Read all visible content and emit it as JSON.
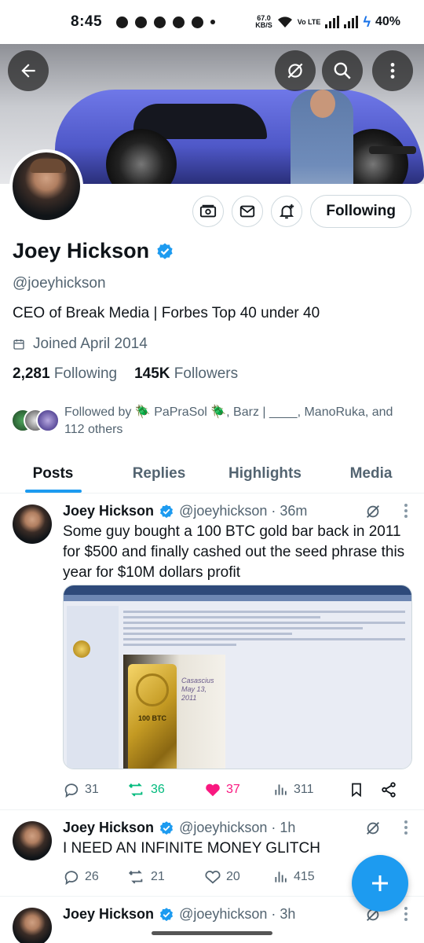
{
  "status_bar": {
    "time": "8:45",
    "net_speed": "67.0",
    "net_unit": "KB/S",
    "volte": "Vo LTE",
    "battery": "40%"
  },
  "profile": {
    "name": "Joey Hickson",
    "handle": "@joeyhickson",
    "bio": "CEO of Break Media | Forbes Top 40 under 40",
    "joined": "Joined April 2014",
    "following_count": "2,281",
    "following_label": "Following",
    "followers_count": "145K",
    "followers_label": "Followers",
    "follow_button": "Following",
    "followed_by": "Followed by 🪲 PaPraSol 🪲, Barz | ____, ManoRuka, and 112 others"
  },
  "tabs": [
    {
      "label": "Posts",
      "active": true
    },
    {
      "label": "Replies",
      "active": false
    },
    {
      "label": "Highlights",
      "active": false
    },
    {
      "label": "Media",
      "active": false
    }
  ],
  "tweets": [
    {
      "name": "Joey Hickson",
      "handle_time": "@joeyhickson · 36m",
      "text": "Some guy bought a 100 BTC gold bar back in 2011 for $500 and finally cashed out the seed phrase this year for $10M dollars profit",
      "replies": "31",
      "retweets": "36",
      "likes": "37",
      "views": "311",
      "media_label": "100 BTC",
      "media_note": "Casascius May 13, 2011"
    },
    {
      "name": "Joey Hickson",
      "handle_time": "@joeyhickson · 1h",
      "text": "I NEED AN INFINITE MONEY GLITCH",
      "replies": "26",
      "retweets": "21",
      "likes": "20",
      "views": "415"
    },
    {
      "name": "Joey Hickson",
      "handle_time": "@joeyhickson · 3h"
    }
  ],
  "colors": {
    "accent": "#1d9bf0",
    "retweet_active": "#00ba7c",
    "like_active": "#f91880",
    "secondary_text": "#536471"
  }
}
